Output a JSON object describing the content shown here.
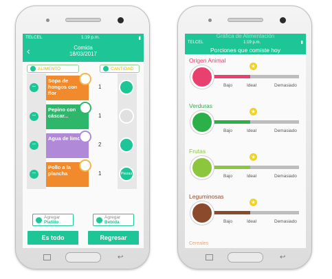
{
  "left_screen": {
    "status": {
      "carrier": "TELCEL",
      "time": "1:19 p.m."
    },
    "header": {
      "title": "Comida",
      "date": "18/03/2017"
    },
    "columns": {
      "food": "ALIMENTO",
      "quantity": "CANTIDAD"
    },
    "items": [
      {
        "name": "Sopa de hongos con flor",
        "qty": "1",
        "color": "#f08a2c"
      },
      {
        "name": "Pepino con cáscar...",
        "qty": "1",
        "color": "#2eb66a"
      },
      {
        "name": "Agua de limón",
        "qty": "2",
        "color": "#b08ad8"
      },
      {
        "name": "Pollo a la plancha",
        "qty": "1",
        "color": "#f08a2c"
      }
    ],
    "circle_label": "Piezas",
    "add_dish": {
      "line1": "Agregar",
      "line2": "Platillo"
    },
    "add_drink": {
      "line1": "Agregar",
      "line2": "Bebida"
    },
    "btn_done": "Es todo",
    "btn_back": "Regresar"
  },
  "right_screen": {
    "status": {
      "carrier": "TELCEL",
      "time": "1:19 p.m."
    },
    "ghost_title": "Gráfica de Alimentación",
    "title": "Porciones que comiste hoy",
    "labels": {
      "low": "Bajo",
      "ideal": "Ideal",
      "high": "Demasiado"
    },
    "categories": [
      {
        "name": "Origen Animal",
        "color": "#e8416f",
        "level": 0.45
      },
      {
        "name": "Verduras",
        "color": "#2bb04a",
        "level": 0.45
      },
      {
        "name": "Frutas",
        "color": "#8cc63f",
        "level": 0.45
      },
      {
        "name": "Leguminosas",
        "color": "#8b4a2b",
        "level": 0.45
      }
    ],
    "next_peek": "Cereales"
  }
}
